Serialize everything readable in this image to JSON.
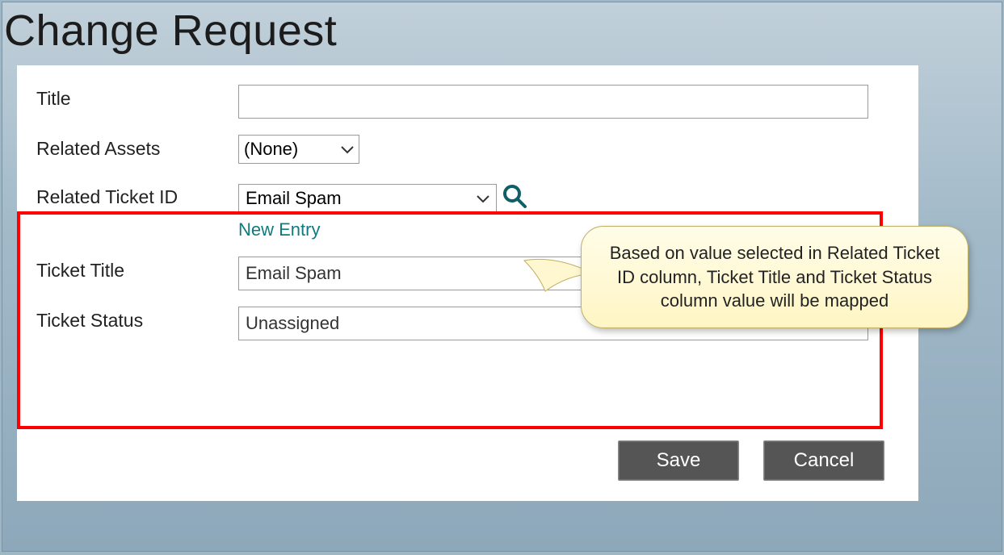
{
  "header": {
    "title": "Change Request"
  },
  "form": {
    "title": {
      "label": "Title",
      "value": ""
    },
    "related_assets": {
      "label": "Related Assets",
      "value": "(None)"
    },
    "related_ticket_id": {
      "label": "Related Ticket ID",
      "value": "Email Spam",
      "new_entry_label": "New Entry"
    },
    "ticket_title": {
      "label": "Ticket Title",
      "value": "Email Spam"
    },
    "ticket_status": {
      "label": "Ticket Status",
      "value": "Unassigned"
    }
  },
  "callout": {
    "text": "Based on value selected in Related Ticket ID column, Ticket Title and Ticket Status column value will be mapped"
  },
  "buttons": {
    "save": "Save",
    "cancel": "Cancel"
  },
  "icons": {
    "search": "search-icon",
    "chevron": "chevron-down-icon"
  }
}
